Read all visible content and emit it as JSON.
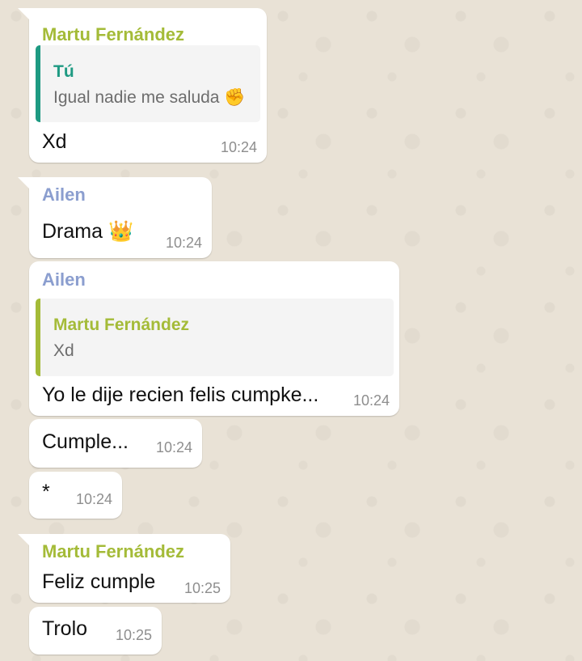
{
  "messages": [
    {
      "sender": "Martu Fernández",
      "quote": {
        "author": "Tú",
        "text": "Igual nadie me saluda ✊"
      },
      "text": "Xd",
      "time": "10:24"
    },
    {
      "sender": "Ailen",
      "text": "Drama 👑",
      "time": "10:24"
    },
    {
      "sender": "Ailen",
      "quote": {
        "author": "Martu Fernández",
        "text": "Xd"
      },
      "text": "Yo le dije recien felis cumpke...",
      "time": "10:24"
    },
    {
      "text": "Cumple...",
      "time": "10:24"
    },
    {
      "text": "*",
      "time": "10:24"
    },
    {
      "sender": "Martu Fernández",
      "text": "Feliz cumple",
      "time": "10:25"
    },
    {
      "text": "Trolo",
      "time": "10:25"
    }
  ],
  "colors": {
    "background": "#e9e2d6",
    "bubble": "#ffffff",
    "martu_name": "#a4bb38",
    "ailen_name": "#8b9ecf",
    "tu_name": "#1e9a82",
    "timestamp": "#8e8e8e"
  }
}
